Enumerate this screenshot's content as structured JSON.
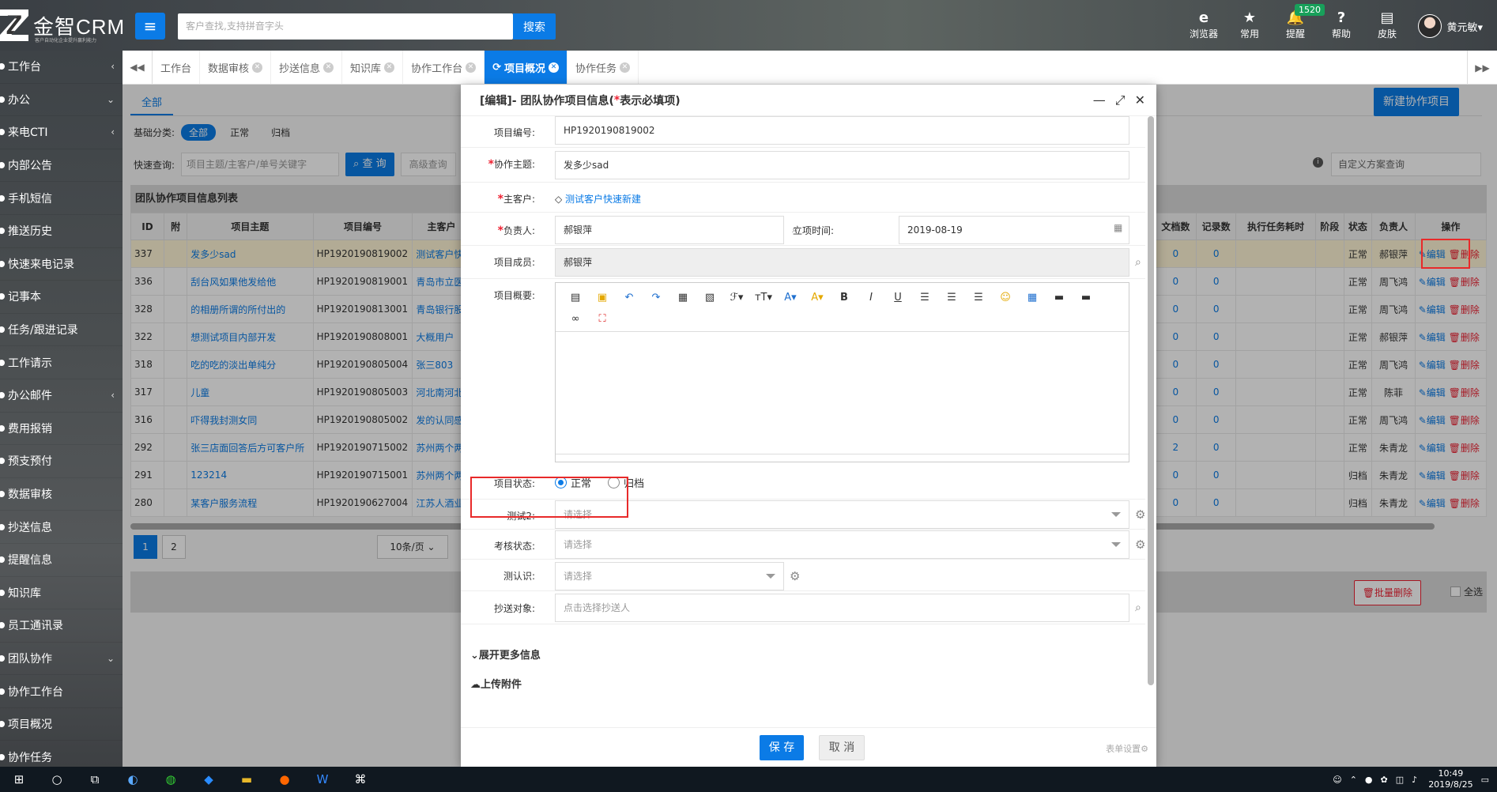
{
  "app": {
    "logo_text": "金智CRM",
    "logo_sub": "客户自动化企业提升赢利能力",
    "search_placeholder": "客户查找,支持拼音字头",
    "search_button": "搜索"
  },
  "top_icons": [
    {
      "icon": "ie-icon",
      "glyph": "e",
      "label": "浏览器"
    },
    {
      "icon": "star-icon",
      "glyph": "★",
      "label": "常用"
    },
    {
      "icon": "bell-icon",
      "glyph": "🔔",
      "label": "提醒",
      "badge": "1520"
    },
    {
      "icon": "help-icon",
      "glyph": "?",
      "label": "帮助"
    },
    {
      "icon": "skin-icon",
      "glyph": "▤",
      "label": "皮肤"
    }
  ],
  "user": {
    "name": "黄元敏▾"
  },
  "sidebar": {
    "items": [
      {
        "label": "工作台",
        "arrow": "‹"
      },
      {
        "label": "办公",
        "arrow": "⌄"
      },
      {
        "label": "来电CTI",
        "arrow": "‹"
      },
      {
        "label": "内部公告",
        "arrow": ""
      },
      {
        "label": "手机短信",
        "arrow": ""
      },
      {
        "label": "推送历史",
        "arrow": ""
      },
      {
        "label": "快速来电记录",
        "arrow": ""
      },
      {
        "label": "记事本",
        "arrow": ""
      },
      {
        "label": "任务/跟进记录",
        "arrow": ""
      },
      {
        "label": "工作请示",
        "arrow": ""
      },
      {
        "label": "办公邮件",
        "arrow": "‹"
      },
      {
        "label": "费用报销",
        "arrow": ""
      },
      {
        "label": "预支预付",
        "arrow": ""
      },
      {
        "label": "数据审核",
        "arrow": ""
      },
      {
        "label": "抄送信息",
        "arrow": ""
      },
      {
        "label": "提醒信息",
        "arrow": ""
      },
      {
        "label": "知识库",
        "arrow": ""
      },
      {
        "label": "员工通讯录",
        "arrow": ""
      },
      {
        "label": "团队协作",
        "arrow": "⌄"
      },
      {
        "label": "协作工作台",
        "arrow": ""
      },
      {
        "label": "项目概况",
        "arrow": ""
      },
      {
        "label": "协作任务",
        "arrow": ""
      }
    ]
  },
  "tabs": [
    {
      "label": "工作台",
      "closable": false,
      "active": false
    },
    {
      "label": "数据审核",
      "closable": true,
      "active": false
    },
    {
      "label": "抄送信息",
      "closable": true,
      "active": false
    },
    {
      "label": "知识库",
      "closable": true,
      "active": false
    },
    {
      "label": "协作工作台",
      "closable": true,
      "active": false
    },
    {
      "label": "项目概况",
      "closable": true,
      "active": true
    },
    {
      "label": "协作任务",
      "closable": true,
      "active": false
    }
  ],
  "page": {
    "subtab": "全部",
    "new_button": "新建协作项目",
    "filter_label": "基础分类:",
    "filters": [
      {
        "label": "全部",
        "on": true
      },
      {
        "label": "正常",
        "on": false
      },
      {
        "label": "归档",
        "on": false
      }
    ],
    "quick_label": "快速查询:",
    "quick_placeholder": "项目主题/主客户/单号关键字",
    "query_button": "查 询",
    "adv_button": "高级查询",
    "scheme_placeholder": "自定义方案查询",
    "list_title": "团队协作项目信息列表",
    "left_headers": [
      "ID",
      "附",
      "项目主题",
      "项目编号",
      "主客户"
    ],
    "right_headers": [
      "文档数",
      "记录数",
      "执行任务耗时",
      "阶段",
      "状态",
      "负责人",
      "操作"
    ],
    "rows": [
      {
        "id": "337",
        "subject": "发多少sad",
        "code": "HP1920190819002",
        "customer": "测试客户快速新建",
        "docs": "0",
        "records": "0",
        "status": "正常",
        "owner": "郝银萍"
      },
      {
        "id": "336",
        "subject": "刮台风如果他发给他",
        "code": "HP1920190819001",
        "customer": "青岛市立医院",
        "docs": "0",
        "records": "0",
        "status": "正常",
        "owner": "周飞鸿"
      },
      {
        "id": "328",
        "subject": "的相册所谓的所付出的",
        "code": "HP1920190813001",
        "customer": "青岛银行股份",
        "docs": "0",
        "records": "0",
        "status": "正常",
        "owner": "周飞鸿"
      },
      {
        "id": "322",
        "subject": "想测试项目内部开发",
        "code": "HP1920190808001",
        "customer": "大概用户",
        "docs": "0",
        "records": "0",
        "status": "正常",
        "owner": "郝银萍"
      },
      {
        "id": "318",
        "subject": "吃的吃的淡出单纯分",
        "code": "HP1920190805004",
        "customer": "张三803",
        "docs": "0",
        "records": "0",
        "status": "正常",
        "owner": "周飞鸿"
      },
      {
        "id": "317",
        "subject": "儿童",
        "code": "HP1920190805003",
        "customer": "河北南河北根",
        "docs": "0",
        "records": "0",
        "status": "正常",
        "owner": "陈菲"
      },
      {
        "id": "316",
        "subject": "吓得我封测女同",
        "code": "HP1920190805002",
        "customer": "发的认同感透",
        "docs": "0",
        "records": "0",
        "status": "正常",
        "owner": "周飞鸿"
      },
      {
        "id": "292",
        "subject": "张三店面回答后方可客户所",
        "code": "HP1920190715002",
        "customer": "苏州两个两个",
        "docs": "2",
        "records": "0",
        "status": "正常",
        "owner": "朱青龙"
      },
      {
        "id": "291",
        "subject": "123214",
        "code": "HP1920190715001",
        "customer": "苏州两个两个",
        "docs": "0",
        "records": "0",
        "status": "归档",
        "owner": "朱青龙"
      },
      {
        "id": "280",
        "subject": "某客户服务流程",
        "code": "HP1920190627004",
        "customer": "江苏人酒业",
        "docs": "0",
        "records": "0",
        "status": "归档",
        "owner": "朱青龙"
      }
    ],
    "op_edit": "✎编辑",
    "op_delete": "🗑删除",
    "pages": [
      "1",
      "2"
    ],
    "per_page": "10条/页 ⌄",
    "batch_delete": "🗑批量删除",
    "select_all": "全选"
  },
  "modal": {
    "title_prefix": "[编辑]- 团队协作项目信息(",
    "title_star": "*",
    "title_suffix": "表示必填项)",
    "fields": {
      "code_label": "项目编号:",
      "code_value": "HP1920190819002",
      "subject_label": "协作主题:",
      "subject_value": "发多少sad",
      "customer_label": "主客户:",
      "customer_value": "测试客户快速新建",
      "owner_label": "负责人:",
      "owner_value": "郝银萍",
      "date_label": "立项时间:",
      "date_value": "2019-08-19",
      "members_label": "项目成员:",
      "members_value": "郝银萍",
      "summary_label": "项目概要:",
      "status_label": "项目状态:",
      "status_options": [
        {
          "label": "正常",
          "checked": true
        },
        {
          "label": "归档",
          "checked": false
        }
      ],
      "test2_label": "测试2:",
      "test2_placeholder": "请选择",
      "review_label": "考核状态:",
      "review_placeholder": "请选择",
      "know_label": "测认识:",
      "know_placeholder": "请选择",
      "cc_label": "抄送对象:",
      "cc_placeholder": "点击选择抄送人"
    },
    "expand_more": "展开更多信息",
    "upload": "上传附件",
    "save": "保 存",
    "cancel": "取 消",
    "form_settings": "表单设置⚙"
  },
  "taskbar": {
    "time": "10:49",
    "date": "2019/8/25"
  }
}
